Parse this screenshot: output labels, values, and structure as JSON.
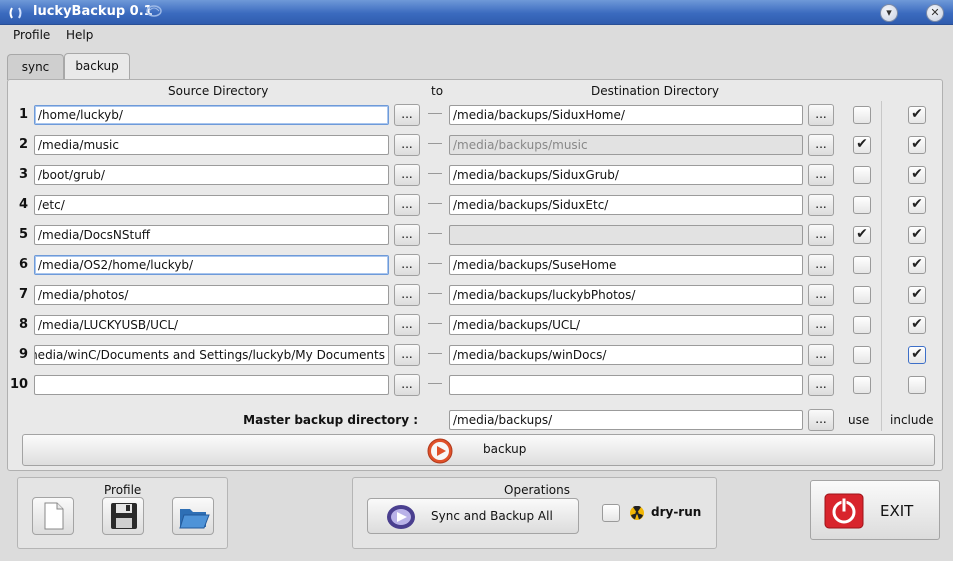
{
  "window": {
    "title": "luckyBackup 0.1"
  },
  "menu": [
    "Profile",
    "Help"
  ],
  "tabs": [
    "sync",
    "backup"
  ],
  "headers": {
    "source": "Source Directory",
    "to": "to",
    "destination": "Destination Directory"
  },
  "rows": [
    {
      "num": "1",
      "source": "/home/luckyb/",
      "dest": "/media/backups/SiduxHome/",
      "dest_disabled": false,
      "use": false,
      "include": true
    },
    {
      "num": "2",
      "source": "/media/music",
      "dest": "/media/backups/music",
      "dest_disabled": true,
      "use": true,
      "include": true
    },
    {
      "num": "3",
      "source": "/boot/grub/",
      "dest": "/media/backups/SiduxGrub/",
      "dest_disabled": false,
      "use": false,
      "include": true
    },
    {
      "num": "4",
      "source": "/etc/",
      "dest": "/media/backups/SiduxEtc/",
      "dest_disabled": false,
      "use": false,
      "include": true
    },
    {
      "num": "5",
      "source": "/media/DocsNStuff",
      "dest": "",
      "dest_disabled": true,
      "use": true,
      "include": true
    },
    {
      "num": "6",
      "source": "/media/OS2/home/luckyb/",
      "dest": "/media/backups/SuseHome",
      "dest_disabled": false,
      "use": false,
      "include": true
    },
    {
      "num": "7",
      "source": "/media/photos/",
      "dest": "/media/backups/luckybPhotos/",
      "dest_disabled": false,
      "use": false,
      "include": true
    },
    {
      "num": "8",
      "source": "/media/LUCKYUSB/UCL/",
      "dest": "/media/backups/UCL/",
      "dest_disabled": false,
      "use": false,
      "include": true
    },
    {
      "num": "9",
      "source": "nedia/winC/Documents and Settings/luckyb/My Documents/",
      "dest": "/media/backups/winDocs/",
      "dest_disabled": false,
      "use": false,
      "include": true
    },
    {
      "num": "10",
      "source": "",
      "dest": "",
      "dest_disabled": false,
      "use": false,
      "include": false
    }
  ],
  "browse_label": "...",
  "master": {
    "label": "Master backup directory :",
    "value": "/media/backups/",
    "use_label": "use",
    "include_label": "include"
  },
  "backup_button": {
    "label": "backup"
  },
  "profile_group": {
    "title": "Profile"
  },
  "operations_group": {
    "title": "Operations",
    "sync_label": "Sync and Backup All",
    "dryrun_label": "dry-run"
  },
  "exit_button": {
    "label": "EXIT"
  },
  "colors": {
    "titlebar": "#3b6bbf",
    "accent": "#3d6fc8",
    "exit": "#d8242c",
    "play": "#e0512a"
  }
}
